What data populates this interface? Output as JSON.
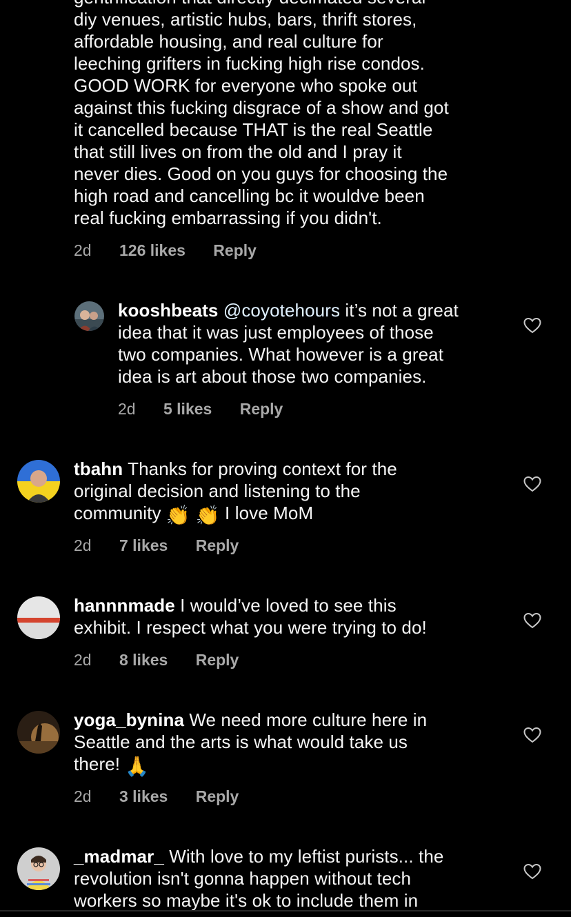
{
  "top_comment": {
    "lines": [
      "gentrification that directly decimated several",
      "diy venues, artistic hubs, bars, thrift stores,",
      "affordable housing, and real culture for",
      "leeching grifters in fucking high rise condos.",
      "GOOD WORK for everyone who spoke out",
      "against this fucking disgrace of a show and got",
      "it cancelled because THAT is the real Seattle",
      "that still lives on from the old and I pray it",
      "never dies. Good on you guys for choosing the",
      "high road and cancelling bc it wouldve been",
      "real fucking embarrassing if you didn't."
    ],
    "time": "2d",
    "likes": "126 likes",
    "reply": "Reply"
  },
  "comments": [
    {
      "username": "kooshbeats",
      "mention": "@coyotehours",
      "lines": [
        " it’s not a great",
        "idea that it was just employees of those",
        "two companies. What however is a great",
        "idea is art about those two companies."
      ],
      "time": "2d",
      "likes": "5 likes",
      "reply": "Reply"
    },
    {
      "username": "tbahn",
      "lines": [
        " Thanks for proving context for the",
        "original decision and listening to the",
        "community ",
        " I love MoM"
      ],
      "emoji": "👏 👏",
      "time": "2d",
      "likes": "7 likes",
      "reply": "Reply"
    },
    {
      "username": "hannnmade",
      "lines": [
        " I would’ve loved to see this",
        "exhibit. I respect what you were trying to do!"
      ],
      "time": "2d",
      "likes": "8 likes",
      "reply": "Reply"
    },
    {
      "username": "yoga_bynina",
      "lines": [
        " We need more culture here in",
        "Seattle and the arts is what would take us",
        "there! "
      ],
      "emoji": "🙏",
      "time": "2d",
      "likes": "3 likes",
      "reply": "Reply"
    },
    {
      "username": "_madmar_",
      "lines": [
        " With love to my leftist purists... the",
        "revolution isn't gonna happen without tech",
        "workers so maybe it's ok to include them in"
      ]
    }
  ],
  "icons": {
    "like": "heart-outline-icon"
  },
  "colors": {
    "background": "#000000",
    "text": "#f5f5f5",
    "meta": "#a8a8a8",
    "mention": "#e0f1ff"
  }
}
